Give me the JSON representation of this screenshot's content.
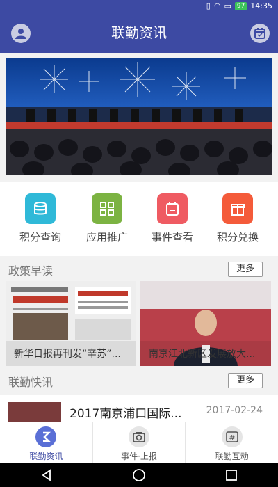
{
  "status": {
    "battery": "97",
    "time": "14:35"
  },
  "header": {
    "title": "联勤资讯"
  },
  "quick_actions": [
    {
      "label": "积分查询",
      "color": "#2fb9d8"
    },
    {
      "label": "应用推广",
      "color": "#7cb342"
    },
    {
      "label": "事件查看",
      "color": "#ef5b62"
    },
    {
      "label": "积分兑换",
      "color": "#f45b3a"
    }
  ],
  "policy": {
    "title": "政策早读",
    "more": "更多",
    "cards": [
      {
        "caption": "新华日报再刊发“辛苏”..."
      },
      {
        "caption": "南京江北新区发展放大..."
      }
    ]
  },
  "news": {
    "title": "联勤快讯",
    "more": "更多",
    "items": [
      {
        "title": "2017南京浦口国际...",
        "date": "2017-02-24"
      }
    ]
  },
  "tabs": [
    {
      "label": "联勤资讯",
      "active": true
    },
    {
      "label": "事件·上报",
      "active": false
    },
    {
      "label": "联勤互动",
      "active": false
    }
  ],
  "colors": {
    "brand": "#3d4aa3"
  }
}
